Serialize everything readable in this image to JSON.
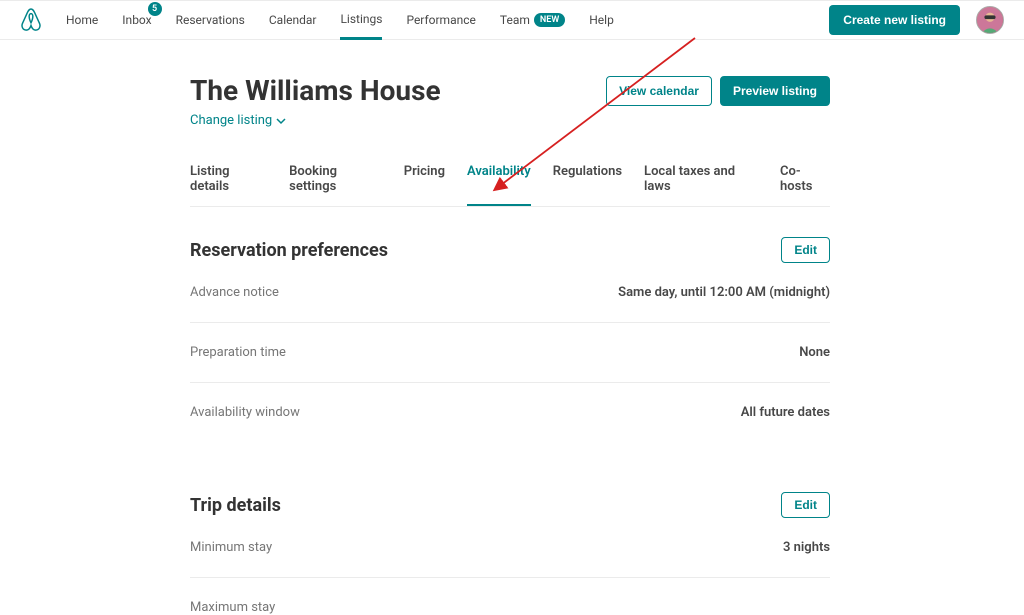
{
  "nav": {
    "home": "Home",
    "inbox": "Inbox",
    "inbox_badge": "5",
    "reservations": "Reservations",
    "calendar": "Calendar",
    "listings": "Listings",
    "performance": "Performance",
    "team": "Team",
    "team_badge": "NEW",
    "help": "Help",
    "create_listing": "Create new listing"
  },
  "header": {
    "title": "The Williams House",
    "change_listing": "Change listing",
    "view_calendar": "View calendar",
    "preview_listing": "Preview listing"
  },
  "tabs": {
    "listing_details": "Listing details",
    "booking_settings": "Booking settings",
    "pricing": "Pricing",
    "availability": "Availability",
    "regulations": "Regulations",
    "local_taxes": "Local taxes and laws",
    "co_hosts": "Co-hosts"
  },
  "reservation_prefs": {
    "title": "Reservation preferences",
    "edit": "Edit",
    "advance_notice_label": "Advance notice",
    "advance_notice_value": "Same day, until 12:00 AM (midnight)",
    "preparation_time_label": "Preparation time",
    "preparation_time_value": "None",
    "availability_window_label": "Availability window",
    "availability_window_value": "All future dates"
  },
  "trip_details": {
    "title": "Trip details",
    "edit": "Edit",
    "min_stay_label": "Minimum stay",
    "min_stay_value": "3 nights",
    "max_stay_label": "Maximum stay"
  }
}
